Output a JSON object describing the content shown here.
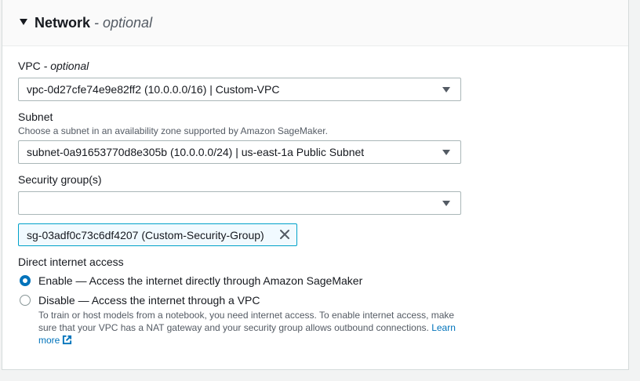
{
  "section": {
    "title": "Network",
    "title_suffix": " - optional"
  },
  "vpc": {
    "label": "VPC",
    "label_suffix": " - optional",
    "value": "vpc-0d27cfe74e9e82ff2 (10.0.0.0/16) | Custom-VPC"
  },
  "subnet": {
    "label": "Subnet",
    "description": "Choose a subnet in an availability zone supported by Amazon SageMaker.",
    "value": "subnet-0a91653770d8e305b (10.0.0.0/24) | us-east-1a Public Subnet"
  },
  "security_groups": {
    "label": "Security group(s)",
    "value": "",
    "tokens": [
      {
        "label": "sg-03adf0c73c6df4207 (Custom-Security-Group)"
      }
    ]
  },
  "internet_access": {
    "label": "Direct internet access",
    "options": [
      {
        "label": "Enable — Access the internet directly through Amazon SageMaker",
        "checked": true
      },
      {
        "label": "Disable — Access the internet through a VPC",
        "checked": false
      }
    ],
    "help_text": "To train or host models from a notebook, you need internet access. To enable internet access, make sure that your VPC has a NAT gateway and your security group allows outbound connections.",
    "learn_more_label": "Learn more"
  },
  "colors": {
    "accent": "#0073bb",
    "token_border": "#00a1c9",
    "token_bg": "#f1faff"
  }
}
